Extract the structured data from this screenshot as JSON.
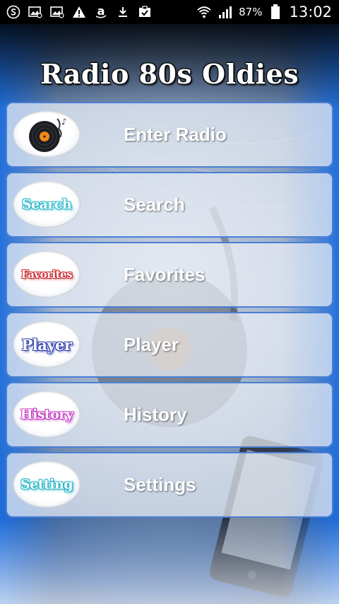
{
  "status_bar": {
    "battery_percent": "87%",
    "time": "13:02",
    "icons": [
      "samsung-s-icon",
      "gallery-icon",
      "gallery-icon",
      "warning-icon",
      "amazon-icon",
      "download-icon",
      "clipboard-check-icon",
      "wifi-icon",
      "signal-icon",
      "battery-icon"
    ]
  },
  "app": {
    "title": "Radio 80s Oldies"
  },
  "menu": {
    "items": [
      {
        "label": "Enter Radio",
        "badge": "",
        "badge_color": ""
      },
      {
        "label": "Search",
        "badge": "Search",
        "badge_color": "#29b6c8"
      },
      {
        "label": "Favorites",
        "badge": "Favorites",
        "badge_color": "#c8262b"
      },
      {
        "label": "Player",
        "badge": "Player",
        "badge_color": "#2f3fae"
      },
      {
        "label": "History",
        "badge": "History",
        "badge_color": "#c239c4"
      },
      {
        "label": "Settings",
        "badge": "Setting",
        "badge_color": "#25b3c6"
      }
    ]
  }
}
